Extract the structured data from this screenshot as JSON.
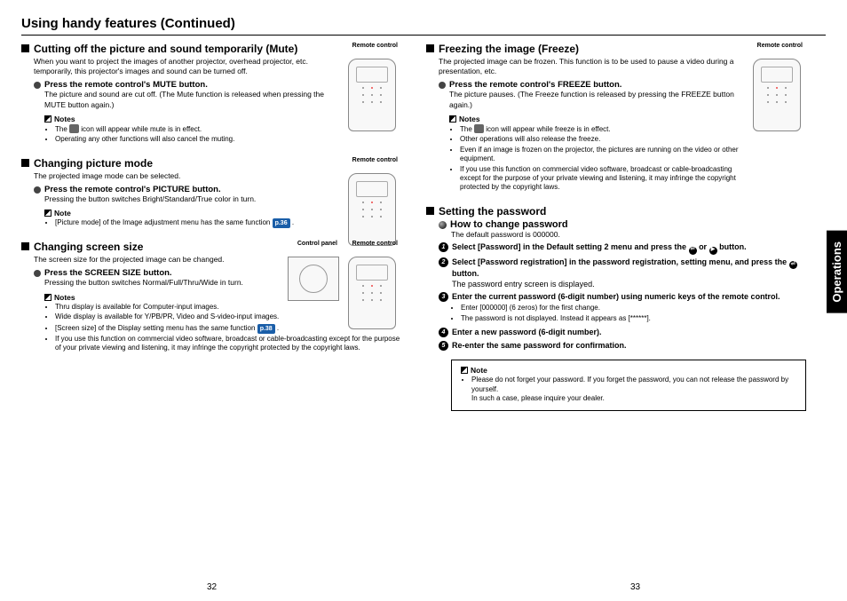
{
  "pageTitle": "Using handy features (Continued)",
  "sideTab": "Operations",
  "pageLeft": "32",
  "pageRight": "33",
  "labels": {
    "remote": "Remote control",
    "control": "Control panel",
    "notes": "Notes",
    "note": "Note"
  },
  "mute": {
    "heading": "Cutting off the picture and sound temporarily (Mute)",
    "desc": "When you want to project the images of another projector, overhead projector, etc. temporarily, this projector's images and sound can be turned off.",
    "step": "Press the remote control's MUTE button.",
    "stepBody": "The picture and sound are cut off. (The Mute function is released when pressing the MUTE button again.)",
    "n1a": "The ",
    "n1b": " icon will appear while mute is in effect.",
    "n2": "Operating any other functions will also cancel the muting."
  },
  "picture": {
    "heading": "Changing picture mode",
    "desc": "The projected image mode can be selected.",
    "step": "Press the remote control's PICTURE button.",
    "stepBody": "Pressing the button switches Bright/Standard/True color in turn.",
    "n1a": "[Picture mode] of the Image adjustment menu has the same function ",
    "ref": "p.36",
    "n1b": " ."
  },
  "screen": {
    "heading": "Changing screen size",
    "desc": "The screen size for the projected image can be changed.",
    "step": "Press the SCREEN SIZE button.",
    "stepBody": "Pressing the button switches Normal/Full/Thru/Wide in turn.",
    "n1": "Thru display is available for Computer-input images.",
    "n2": "Wide display is available for Y/PB/PR, Video and S-video-input images.",
    "n3a": "[Screen size] of the Display setting menu has the same function ",
    "ref": "p.38",
    "n3b": " .",
    "n4": "If you use this function on commercial video software, broadcast or cable-broadcasting except for the purpose of your private viewing and listening, it may infringe the copyright protected by the copyright laws."
  },
  "freeze": {
    "heading": "Freezing the image (Freeze)",
    "desc": "The projected image can be frozen. This function is to be used to pause a video during a presentation, etc.",
    "step": "Press the remote control's FREEZE button.",
    "stepBody": "The picture pauses. (The Freeze function is released by pressing the FREEZE button again.)",
    "n1a": "The ",
    "n1b": " icon will appear while freeze is in effect.",
    "n2": "Other operations will also release the freeze.",
    "n3": "Even if an image is frozen on the projector, the pictures are running on the video or other equipment.",
    "n4": "If you use this function on commercial video software, broadcast or cable-broadcasting except for the purpose of your private viewing and listening, it may infringe the copyright protected by the copyright laws."
  },
  "password": {
    "heading": "Setting the password",
    "howto": "How to change password",
    "default": "The default password is 000000.",
    "s1": "Select [Password] in the Default setting 2 menu and press the 🅞 or 🅞 button.",
    "s2": "Select [Password registration] in the password registration, setting menu, and press the 🅞 button.",
    "s2b": "The password entry screen is displayed.",
    "s3": "Enter the current password (6-digit number) using numeric keys of the remote control.",
    "s3n1": "Enter [000000] (6 zeros) for the first change.",
    "s3n2": "The password is not displayed. Instead it appears as [******].",
    "s4": "Enter a new password (6-digit number).",
    "s5": "Re-enter the same password for confirmation.",
    "boxNote": "Please do not forget your password. If you forget the password, you can not release the password by yourself.",
    "boxNote2": "In such a case, please inquire your dealer."
  }
}
